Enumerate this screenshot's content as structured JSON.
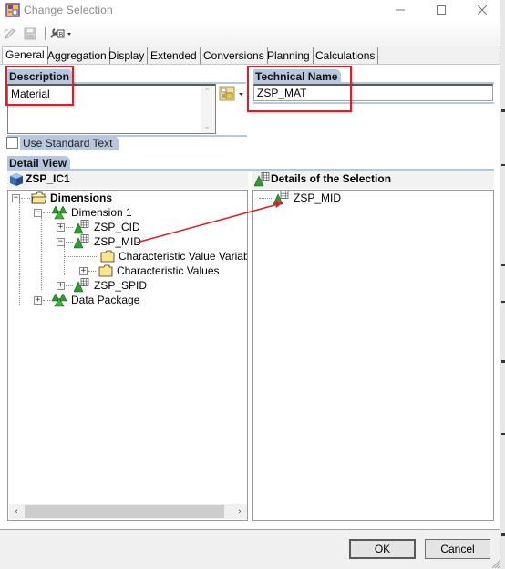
{
  "window": {
    "title": "Change Selection"
  },
  "toolbar": {
    "items": [
      "pencil-icon",
      "save-icon",
      "tool-settings-icon"
    ]
  },
  "tabs": [
    {
      "label": "General",
      "active": true
    },
    {
      "label": "Aggregation",
      "active": false
    },
    {
      "label": "Display",
      "active": false
    },
    {
      "label": "Extended",
      "active": false
    },
    {
      "label": "Conversions",
      "active": false
    },
    {
      "label": "Planning",
      "active": false
    },
    {
      "label": "Calculations",
      "active": false
    }
  ],
  "general": {
    "description_label": "Description",
    "description_value": "Material",
    "use_standard_text_label": "Use Standard Text",
    "use_standard_text_checked": false,
    "technical_name_label": "Technical Name",
    "technical_name_value": "ZSP_MAT",
    "detail_view_label": "Detail View"
  },
  "left_panel": {
    "title": "ZSP_IC1",
    "tree": [
      {
        "label": "Dimensions",
        "bold": true,
        "icon": "folder-open-icon",
        "expander": "minus"
      },
      {
        "label": "Dimension 1",
        "icon": "dimension-icon",
        "expander": "minus"
      },
      {
        "label": "ZSP_CID",
        "icon": "characteristic-icon",
        "expander": "plus"
      },
      {
        "label": "ZSP_MID",
        "icon": "characteristic-icon",
        "expander": "minus"
      },
      {
        "label": "Characteristic Value Variables",
        "icon": "folder-icon",
        "expander": "none"
      },
      {
        "label": "Characteristic Values",
        "icon": "folder-icon",
        "expander": "plus"
      },
      {
        "label": "ZSP_SPID",
        "icon": "characteristic-icon",
        "expander": "plus"
      },
      {
        "label": "Data Package",
        "icon": "dimension-icon",
        "expander": "plus"
      }
    ]
  },
  "right_panel": {
    "title": "Details of the Selection",
    "items": [
      {
        "label": "ZSP_MID",
        "icon": "characteristic-icon"
      }
    ]
  },
  "buttons": {
    "ok": "OK",
    "cancel": "Cancel"
  },
  "colors": {
    "group_header": "#b7c7de",
    "annotation_red": "#d9202a",
    "tree_icon_green": "#2e9b2e"
  }
}
